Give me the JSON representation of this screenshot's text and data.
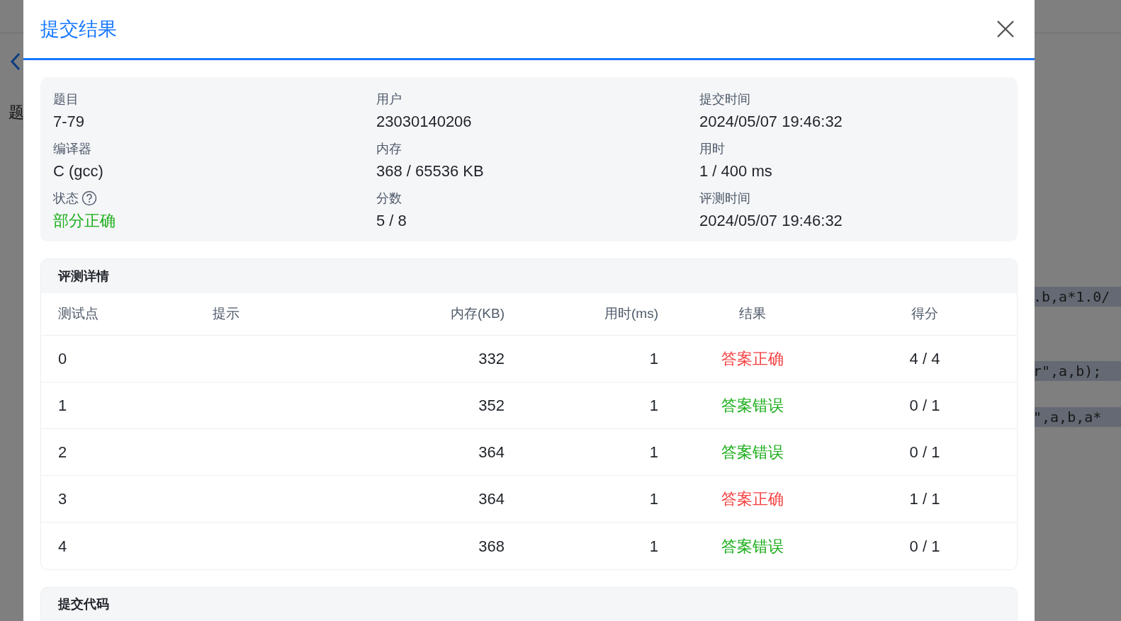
{
  "background": {
    "left_text": "题",
    "code_lines": [
      ".b,a*1.0/",
      "r\",a,b);",
      "\",a,b,a*"
    ]
  },
  "dialog": {
    "title": "提交结果",
    "info": [
      {
        "label": "题目",
        "value": "7-79"
      },
      {
        "label": "用户",
        "value": "23030140206"
      },
      {
        "label": "提交时间",
        "value": "2024/05/07 19:46:32"
      },
      {
        "label": "编译器",
        "value": "C (gcc)"
      },
      {
        "label": "内存",
        "value": "368 / 65536 KB"
      },
      {
        "label": "用时",
        "value": "1 / 400 ms"
      },
      {
        "label": "状态",
        "value": "部分正确",
        "help": true,
        "color": "#1aad19"
      },
      {
        "label": "分数",
        "value": "5 / 8"
      },
      {
        "label": "评测时间",
        "value": "2024/05/07 19:46:32"
      }
    ],
    "details": {
      "title": "评测详情",
      "columns": [
        "测试点",
        "提示",
        "内存(KB)",
        "用时(ms)",
        "结果",
        "得分"
      ],
      "rows": [
        {
          "case": "0",
          "hint": "",
          "memory": "332",
          "time": "1",
          "result": "答案正确",
          "color": "#f53f3f",
          "score": "4 / 4"
        },
        {
          "case": "1",
          "memory": "352",
          "time": "1",
          "result": "答案错误",
          "color": "#1aad19",
          "score": "0 / 1"
        },
        {
          "case": "2",
          "memory": "364",
          "time": "1",
          "result": "答案错误",
          "color": "#1aad19",
          "score": "0 / 1"
        },
        {
          "case": "3",
          "memory": "364",
          "time": "1",
          "result": "答案正确",
          "color": "#f53f3f",
          "score": "1 / 1"
        },
        {
          "case": "4",
          "memory": "368",
          "time": "1",
          "result": "答案错误",
          "color": "#1aad19",
          "score": "0 / 1"
        }
      ]
    },
    "code_section": {
      "title": "提交代码"
    }
  }
}
